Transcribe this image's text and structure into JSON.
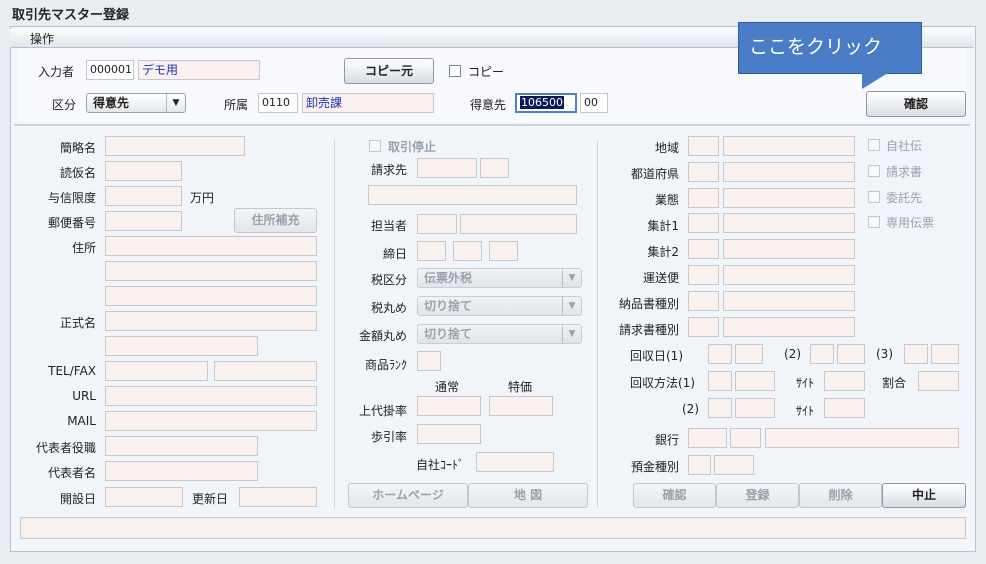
{
  "window": {
    "title": "取引先マスター登録"
  },
  "menu": {
    "operation": "操作"
  },
  "callout": {
    "text": "ここをクリック"
  },
  "header": {
    "entrant_label": "入力者",
    "entrant_code": "000001",
    "entrant_name": "デモ用",
    "copy_source_button": "コピー元",
    "copy_checkbox_label": "コピー",
    "category_label": "区分",
    "category_value": "得意先",
    "dept_label": "所属",
    "dept_code": "0110",
    "dept_name": "卸売課",
    "customer_label": "得意先",
    "customer_code": "106500",
    "customer_branch": "00",
    "confirm_button": "確認"
  },
  "left": {
    "short_name": "簡略名",
    "kana_name": "読仮名",
    "credit_limit": "与信限度",
    "credit_unit": "万円",
    "postal_code": "郵便番号",
    "address_fill_button": "住所補充",
    "address": "住所",
    "formal_name": "正式名",
    "tel_fax": "TEL/FAX",
    "url": "URL",
    "mail": "MAIL",
    "rep_title": "代表者役職",
    "rep_name": "代表者名",
    "open_date": "開設日",
    "update_date": "更新日"
  },
  "middle": {
    "suspend_label": "取引停止",
    "billing_to": "請求先",
    "staff": "担当者",
    "closing_day": "締日",
    "tax_class": "税区分",
    "tax_class_value": "伝票外税",
    "tax_rounding": "税丸め",
    "tax_rounding_value": "切り捨て",
    "amount_rounding": "金額丸め",
    "amount_rounding_value": "切り捨て",
    "product_rank": "商品ﾗﾝｸ",
    "normal_col": "通常",
    "special_col": "特価",
    "base_rate": "上代掛率",
    "margin_rate": "歩引率",
    "own_code": "自社ｺｰﾄﾞ",
    "homepage_button": "ホームページ",
    "map_button": "地 図"
  },
  "right": {
    "region": "地域",
    "prefecture": "都道府県",
    "business_type": "業態",
    "aggregate1": "集計1",
    "aggregate2": "集計2",
    "carrier": "運送便",
    "delivery_note_type": "納品書種別",
    "invoice_type": "請求書種別",
    "own_company_chk": "自社伝",
    "invoice_chk": "請求書",
    "consign_chk": "委託先",
    "dedicated_slip_chk": "専用伝票",
    "collection_day": "回収日(1)",
    "collection_day2": "(2)",
    "collection_day3": "(3)",
    "collection_method": "回収方法(1)",
    "site_label": "ｻｲﾄ",
    "ratio_label": "割合",
    "collection_method2": "(2)",
    "site_label2": "ｻｲﾄ",
    "bank": "銀行",
    "deposit_type": "預金種別"
  },
  "footer": {
    "confirm_button": "確認",
    "register_button": "登録",
    "delete_button": "削除",
    "cancel_button": "中止"
  }
}
